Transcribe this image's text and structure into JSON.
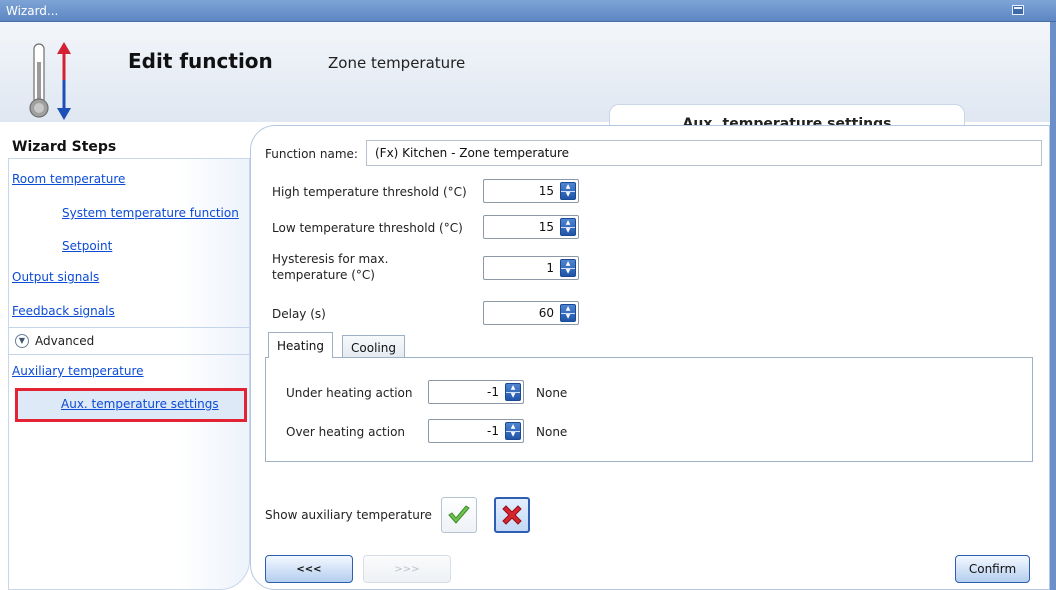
{
  "window": {
    "title": "Wizard..."
  },
  "header": {
    "title": "Edit function",
    "subtitle": "Zone temperature",
    "step_title": "Aux. temperature settings"
  },
  "sidebar": {
    "heading": "Wizard Steps",
    "items": [
      {
        "label": "Room temperature"
      },
      {
        "label": "System temperature function"
      },
      {
        "label": "Setpoint"
      },
      {
        "label": "Output signals"
      },
      {
        "label": "Feedback signals"
      }
    ],
    "advanced_label": "Advanced",
    "advanced_items": [
      {
        "label": "Auxiliary temperature"
      },
      {
        "label": "Aux. temperature settings"
      }
    ]
  },
  "form": {
    "function_name_label": "Function name:",
    "function_name_value": "(Fx) Kitchen - Zone temperature",
    "high_threshold": {
      "label": "High temperature threshold (°C)",
      "value": "15"
    },
    "low_threshold": {
      "label": "Low temperature threshold (°C)",
      "value": "15"
    },
    "hysteresis": {
      "label_line1": "Hysteresis for max.",
      "label_line2": "temperature (°C)",
      "value": "1"
    },
    "delay": {
      "label": "Delay (s)",
      "value": "60"
    },
    "tabs": [
      {
        "label": "Heating"
      },
      {
        "label": "Cooling"
      }
    ],
    "under_heating": {
      "label": "Under heating action",
      "value": "-1",
      "desc": "None"
    },
    "over_heating": {
      "label": "Over heating action",
      "value": "-1",
      "desc": "None"
    },
    "show_aux_label": "Show auxiliary temperature"
  },
  "nav": {
    "prev_label": "<<<",
    "next_label": ">>>",
    "confirm_label": "Confirm"
  },
  "colors": {
    "title_bar": "#6b8fc6",
    "link": "#0b4bd6",
    "selected_outline": "#e32233",
    "spin_arrow": "#2f63b7",
    "check_green": "#5cb85c",
    "x_red": "#d9232d"
  },
  "icons": {
    "logo": "thermometer-arrows-icon",
    "confirm_check": "check-icon",
    "reject_x": "x-icon",
    "advanced_toggle": "chevron-circle-icon"
  }
}
